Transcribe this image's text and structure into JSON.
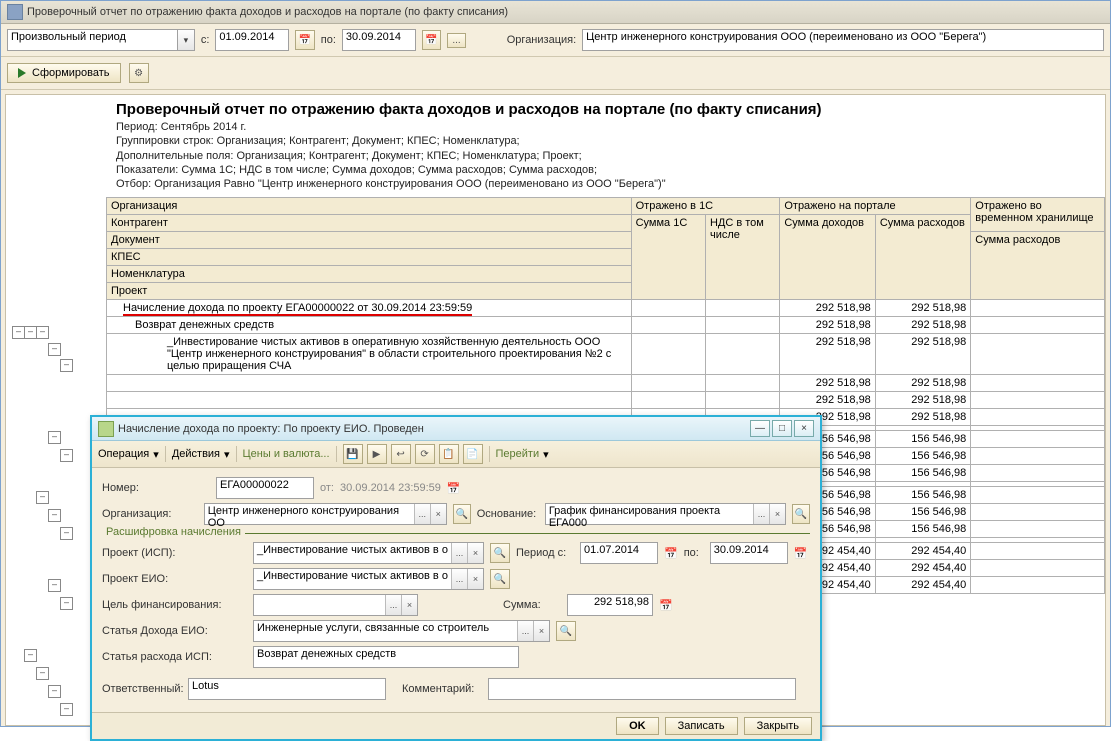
{
  "window": {
    "title": "Проверочный отчет по отражению факта доходов и расходов на портале (по факту списания)"
  },
  "toolbar": {
    "period_label": "Произвольный период",
    "s_label": "с:",
    "date_from": "01.09.2014",
    "po_label": "по:",
    "date_to": "30.09.2014",
    "ellipsis": "...",
    "org_label": "Организация:",
    "org_value": "Центр инженерного конструирования ООО (переименовано из ООО \"Берега\")",
    "generate": "Сформировать"
  },
  "report_header": {
    "title": "Проверочный отчет по отражению факта доходов и расходов на портале (по факту списания)",
    "period": "Период: Сентябрь 2014 г.",
    "grouping": "Группировки строк: Организация; Контрагент; Документ; КПЕС; Номенклатура;",
    "extra": "Дополнительные поля: Организация; Контрагент; Документ; КПЕС; Номенклатура; Проект;",
    "indicators": "Показатели: Сумма 1С; НДС в том числе; Сумма доходов; Сумма расходов; Сумма расходов;",
    "filter": "Отбор: Организация Равно \"Центр инженерного конструирования ООО (переименовано из ООО \"Берега\")\""
  },
  "columns": {
    "org": "Организация",
    "in1c": "Отражено в 1С",
    "portal": "Отражено на портале",
    "store": "Отражено во временном хранилище",
    "contr": "Контрагент",
    "doc": "Документ",
    "kpes": "КПЕС",
    "nom": "Номенклатура",
    "proj": "Проект",
    "sum1c": "Сумма 1С",
    "vat": "НДС в том числе",
    "sum_in": "Сумма доходов",
    "sum_out": "Сумма расходов",
    "sum_out2": "Сумма расходов"
  },
  "rows": {
    "r1_label": "Начисление дохода по проекту ЕГА00000022 от 30.09.2014 23:59:59",
    "r2_label": "Возврат денежных средств",
    "r3_label": "_Инвестирование чистых активов в оперативную хозяйственную деятельность ООО \"Центр инженерного конструирования\" в области строительного проектирования №2 с целью приращения СЧА",
    "val_292518": "292 518,98",
    "val_156546": "156 546,98",
    "val_292454": "292 454,40"
  },
  "dialog": {
    "title": "Начисление дохода по проекту: По проекту ЕИО. Проведен",
    "menu_op": "Операция",
    "menu_act": "Действия",
    "menu_price": "Цены и валюта...",
    "menu_go": "Перейти",
    "num_label": "Номер:",
    "num_value": "ЕГА00000022",
    "ot": "от:",
    "date": "30.09.2014 23:59:59",
    "org_label": "Организация:",
    "org_value": "Центр инженерного конструирования ОО",
    "basis_label": "Основание:",
    "basis_value": "График финансирования проекта ЕГА000",
    "group": "Расшифровка начисления",
    "proj_isp_label": "Проект (ИСП):",
    "proj_isp_value": "_Инвестирование чистых активов в о",
    "period_s": "Период с:",
    "period_from": "01.07.2014",
    "period_po": "по:",
    "period_to": "30.09.2014",
    "proj_eio_label": "Проект ЕИО:",
    "proj_eio_value": "_Инвестирование чистых активов в о",
    "fin_label": "Цель финансирования:",
    "sum_label": "Сумма:",
    "sum_value": "292 518,98",
    "income_label": "Статья Дохода ЕИО:",
    "income_value": "Инженерные услуги, связанные со строитель",
    "expense_label": "Статья расхода ИСП:",
    "expense_value": "Возврат денежных средств",
    "resp_label": "Ответственный:",
    "resp_value": "Lotus",
    "comment_label": "Комментарий:",
    "ok": "OK",
    "write": "Записать",
    "close": "Закрыть",
    "ellipsis": "...",
    "x": "×",
    "q": "Q"
  }
}
